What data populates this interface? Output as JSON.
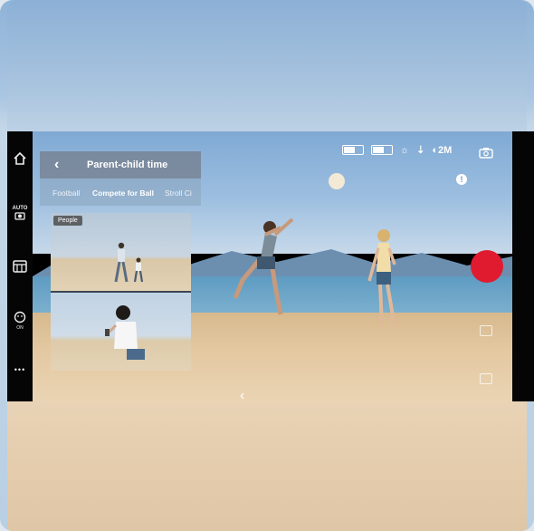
{
  "panel": {
    "back_symbol": "‹",
    "title": "Parent-child time",
    "tabs": [
      "Football",
      "Compete for Ball",
      "Stroll Ci"
    ],
    "active_tab": "Compete for Ball",
    "thumbnail_tag": "People"
  },
  "left_bar": {
    "auto_label": "AUTO",
    "on_label": "ON",
    "more_symbol": "•••"
  },
  "status": {
    "zoom": "2M",
    "info_symbol": "!"
  },
  "colors": {
    "record": "#e01b30",
    "panel_header": "#78849499"
  },
  "icons": [
    "home-icon",
    "auto-camera-icon",
    "grid-icon",
    "face-track-icon",
    "more-icon",
    "battery-icon",
    "flash-icon",
    "wifi-icon",
    "camera-switch-icon",
    "info-icon",
    "chevron-left-icon",
    "record-button"
  ]
}
